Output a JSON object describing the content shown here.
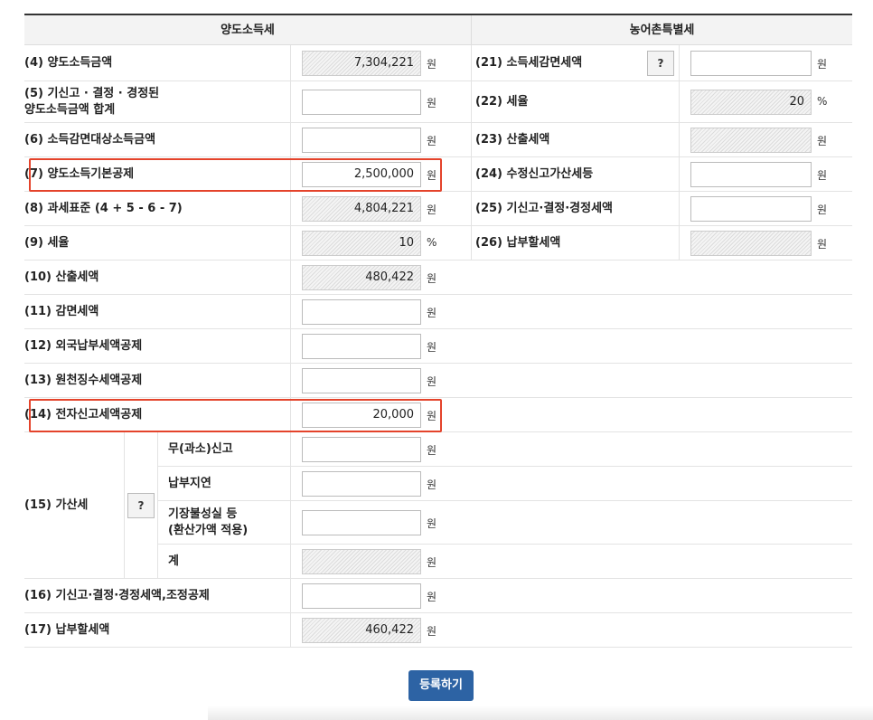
{
  "headers": {
    "left": "양도소득세",
    "right": "농어촌특별세"
  },
  "left_rows": [
    {
      "label": "(4) 양도소득금액",
      "value": "7,304,221",
      "unit": "원",
      "readonly": true
    },
    {
      "label": "(5) 기신고 · 결정 · 경정된\n양도소득금액 합계",
      "value": "",
      "unit": "원",
      "readonly": false
    },
    {
      "label": "(6) 소득감면대상소득금액",
      "value": "",
      "unit": "원",
      "readonly": false
    },
    {
      "label": "(7) 양도소득기본공제",
      "value": "2,500,000",
      "unit": "원",
      "readonly": false
    },
    {
      "label": "(8) 과세표준 (4 + 5 - 6 - 7)",
      "value": "4,804,221",
      "unit": "원",
      "readonly": true
    },
    {
      "label": "(9) 세율",
      "value": "10",
      "unit": "%",
      "readonly": true
    },
    {
      "label": "(10) 산출세액",
      "value": "480,422",
      "unit": "원",
      "readonly": true
    },
    {
      "label": "(11) 감면세액",
      "value": "",
      "unit": "원",
      "readonly": false
    },
    {
      "label": "(12) 외국납부세액공제",
      "value": "",
      "unit": "원",
      "readonly": false
    },
    {
      "label": "(13) 원천징수세액공제",
      "value": "",
      "unit": "원",
      "readonly": false
    },
    {
      "label": "(14) 전자신고세액공제",
      "value": "20,000",
      "unit": "원",
      "readonly": false
    }
  ],
  "penalty": {
    "label": "(15) 가산세",
    "help": "?",
    "items": [
      {
        "label": "무(과소)신고",
        "value": "",
        "unit": "원",
        "readonly": false
      },
      {
        "label": "납부지연",
        "value": "",
        "unit": "원",
        "readonly": false
      },
      {
        "label": "기장불성실 등\n(환산가액 적용)",
        "value": "",
        "unit": "원",
        "readonly": false
      },
      {
        "label": "계",
        "value": "",
        "unit": "원",
        "readonly": true
      }
    ]
  },
  "bottom_rows": [
    {
      "label": "(16) 기신고·결정·경정세액,조정공제",
      "value": "",
      "unit": "원",
      "readonly": false
    },
    {
      "label": "(17) 납부할세액",
      "value": "460,422",
      "unit": "원",
      "readonly": true
    }
  ],
  "right_rows": [
    {
      "label": "(21) 소득세감면세액",
      "help": "?",
      "value": "",
      "unit": "원",
      "readonly": false
    },
    {
      "label": "(22) 세율",
      "value": "20",
      "unit": "%",
      "readonly": true
    },
    {
      "label": "(23) 산출세액",
      "value": "",
      "unit": "원",
      "readonly": true
    },
    {
      "label": "(24) 수정신고가산세등",
      "value": "",
      "unit": "원",
      "readonly": false
    },
    {
      "label": "(25) 기신고·결정·경정세액",
      "value": "",
      "unit": "원",
      "readonly": false
    },
    {
      "label": "(26) 납부할세액",
      "value": "",
      "unit": "원",
      "readonly": true
    }
  ],
  "submit_label": "등록하기",
  "highlight_color": "#e4432b",
  "primary_color": "#2d63a4"
}
